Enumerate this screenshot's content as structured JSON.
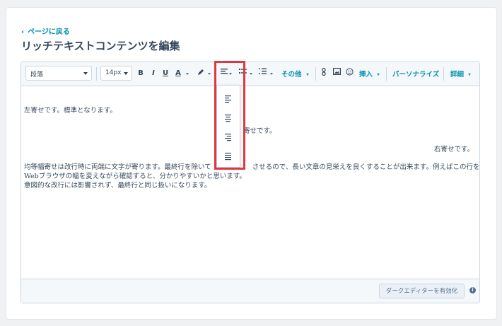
{
  "nav": {
    "back_label": "ページに戻る"
  },
  "page": {
    "title": "リッチテキストコンテンツを編集"
  },
  "toolbar": {
    "paragraph_select": "段落",
    "size_select": "14px",
    "bold": "B",
    "italic": "I",
    "underline": "U",
    "text_color_letter": "A",
    "more_label": "その他",
    "insert_label": "挿入",
    "personalize_label": "パーソナライズ",
    "advanced_label": "詳細"
  },
  "content": {
    "lines": [
      "左寄せです。標準となります。",
      "寄せです。",
      "右寄せです。",
      "均等幅寄せは改行時に両端に文字が寄ります。最終行を除いて",
      "させるので、長い文章の見栄えを良くすることが出来ます。例えばこの行を",
      "Webブラウザの幅を変えながら確認すると、分かりやすいかと思います。",
      "意図的な改行には影響されず、最終行と同じ扱いになります。"
    ]
  },
  "footer": {
    "dark_editor_label": "ダークエディターを有効化",
    "info_glyph": "i"
  },
  "colors": {
    "accent": "#0091ae",
    "text": "#33475b",
    "highlight": "#e0383e"
  }
}
